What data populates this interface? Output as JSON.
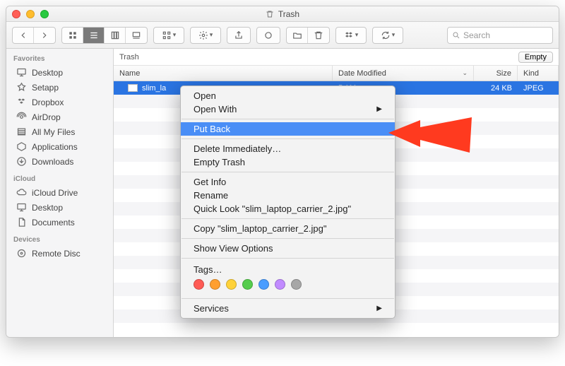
{
  "window_title": "Trash",
  "toolbar": {
    "search_placeholder": "Search"
  },
  "sidebar": {
    "sections": [
      {
        "title": "Favorites",
        "items": [
          "Desktop",
          "Setapp",
          "Dropbox",
          "AirDrop",
          "All My Files",
          "Applications",
          "Downloads"
        ]
      },
      {
        "title": "iCloud",
        "items": [
          "iCloud Drive",
          "Desktop",
          "Documents"
        ]
      },
      {
        "title": "Devices",
        "items": [
          "Remote Disc"
        ]
      }
    ]
  },
  "pathbar": {
    "location": "Trash",
    "empty_label": "Empty"
  },
  "columns": {
    "name": "Name",
    "date": "Date Modified",
    "size": "Size",
    "kind": "Kind"
  },
  "file": {
    "name": "slim_la",
    "date": "5 AM",
    "size": "24 KB",
    "kind": "JPEG"
  },
  "context_menu": {
    "open": "Open",
    "open_with": "Open With",
    "put_back": "Put Back",
    "delete_immediately": "Delete Immediately…",
    "empty_trash": "Empty Trash",
    "get_info": "Get Info",
    "rename": "Rename",
    "quick_look": "Quick Look \"slim_laptop_carrier_2.jpg\"",
    "copy": "Copy \"slim_laptop_carrier_2.jpg\"",
    "show_view_options": "Show View Options",
    "tags": "Tags…",
    "services": "Services",
    "tag_colors": [
      "#ff5b55",
      "#ff9f2f",
      "#ffd23a",
      "#55cd4d",
      "#4a9dff",
      "#c18bff",
      "#a7a7a7"
    ]
  }
}
